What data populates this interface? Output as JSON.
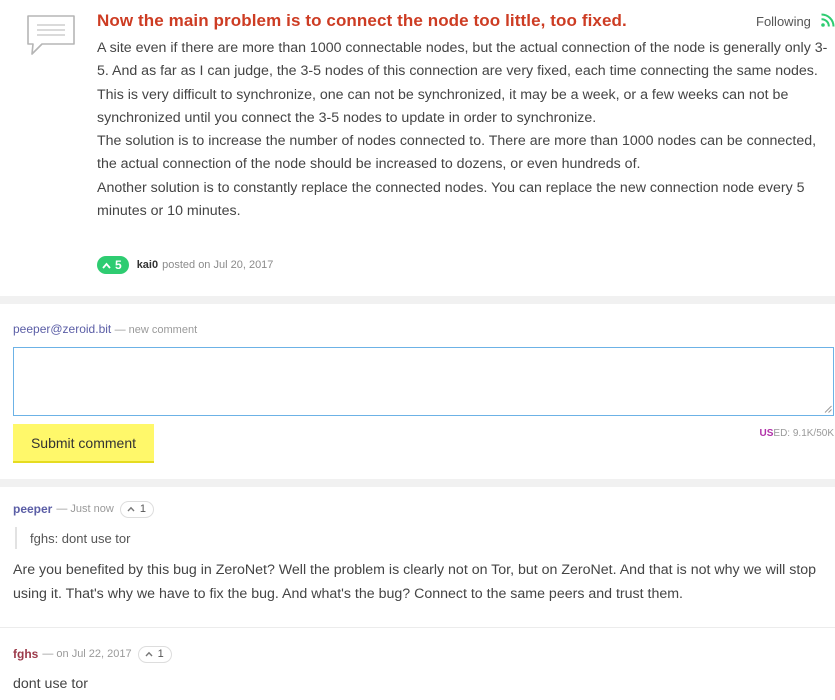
{
  "topic": {
    "title": "Now the main problem is to connect the node too little, too fixed.",
    "follow_label": "Following",
    "paragraphs": [
      "A site even if there are more than 1000 connectable nodes, but the actual connection of the node is generally only 3-5. And as far as I can judge, the 3-5 nodes of this connection are very fixed, each time connecting the same nodes.",
      "This is very difficult to synchronize, one can not be synchronized, it may be a week, or a few weeks can not be synchronized until you connect the 3-5 nodes to update in order to synchronize.",
      "The solution is to increase the number of nodes connected to. There are more than 1000 nodes can be connected, the actual connection of the node should be increased to dozens, or even hundreds of.",
      "Another solution is to constantly replace the connected nodes. You can replace the new connection node every 5 minutes or 10 minutes."
    ],
    "votes": "5",
    "author": "kai0",
    "posted_text": "posted on Jul 20, 2017",
    "icons": {
      "topic": "speech-bubble-icon",
      "follow": "rss-feed-icon",
      "vote": "chevron-up-icon"
    }
  },
  "new_comment": {
    "user": "peeper@zeroid.bit",
    "sub": "— new comment",
    "textarea_value": "",
    "submit_label": "Submit comment",
    "used_prefix": "US",
    "used_rest": "ED: 9.1K/50K"
  },
  "comments": [
    {
      "user": "peeper",
      "time": "— Just now",
      "score": "1",
      "quote_author": "fghs:",
      "quote_text": " dont use tor",
      "body": "Are you benefited by this bug in ZeroNet? Well the problem is clearly not on Tor, but on ZeroNet. And that is not why we will stop using it. That's why we have to fix the bug. And what's the bug? Connect to the same peers and trust them."
    },
    {
      "user": "fghs",
      "time": "— on Jul 22, 2017",
      "score": "1",
      "body": "dont use tor"
    }
  ],
  "colors": {
    "title_red": "#cd3c23",
    "vote_green": "#2ecc71",
    "rss_green": "#2ecc71",
    "submit_yellow": "#fff86a",
    "user_peeper": "#5b5ea6",
    "user_fghs": "#9c3a4a",
    "textarea_border": "#6cb2e6",
    "used_highlight": "#b030a8"
  }
}
